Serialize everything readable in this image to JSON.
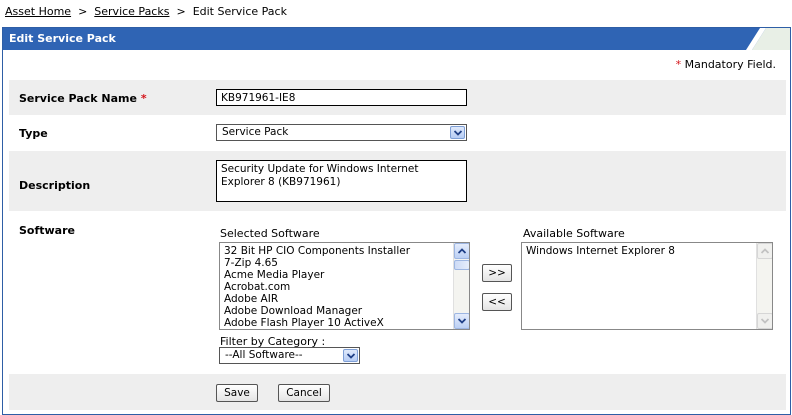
{
  "breadcrumb": {
    "home": "Asset Home",
    "service_packs": "Service Packs",
    "current": "Edit Service Pack",
    "separator": ">"
  },
  "panel": {
    "title": "Edit Service Pack",
    "mandatory_star": "*",
    "mandatory_text": "Mandatory Field."
  },
  "form": {
    "name_label": "Service Pack Name",
    "name_value": "KB971961-IE8",
    "type_label": "Type",
    "type_value": "Service Pack",
    "description_label": "Description",
    "description_value": "Security Update for Windows Internet Explorer 8 (KB971961)",
    "software_label": "Software",
    "selected_label": "Selected Software",
    "selected_items": [
      "32 Bit HP CIO Components Installer",
      "7-Zip 4.65",
      "Acme Media Player",
      "Acrobat.com",
      "Adobe AIR",
      "Adobe Download Manager",
      "Adobe Flash Player 10 ActiveX"
    ],
    "available_label": "Available Software",
    "available_items": [
      "Windows Internet Explorer 8"
    ],
    "add_button": ">>",
    "remove_button": "<<",
    "filter_label": "Filter by Category :",
    "filter_value": "--All Software--"
  },
  "actions": {
    "save": "Save",
    "cancel": "Cancel"
  },
  "colors": {
    "header_blue": "#2f64b4",
    "row_grey": "#eeeeee",
    "mandatory_red": "#d4141a"
  }
}
